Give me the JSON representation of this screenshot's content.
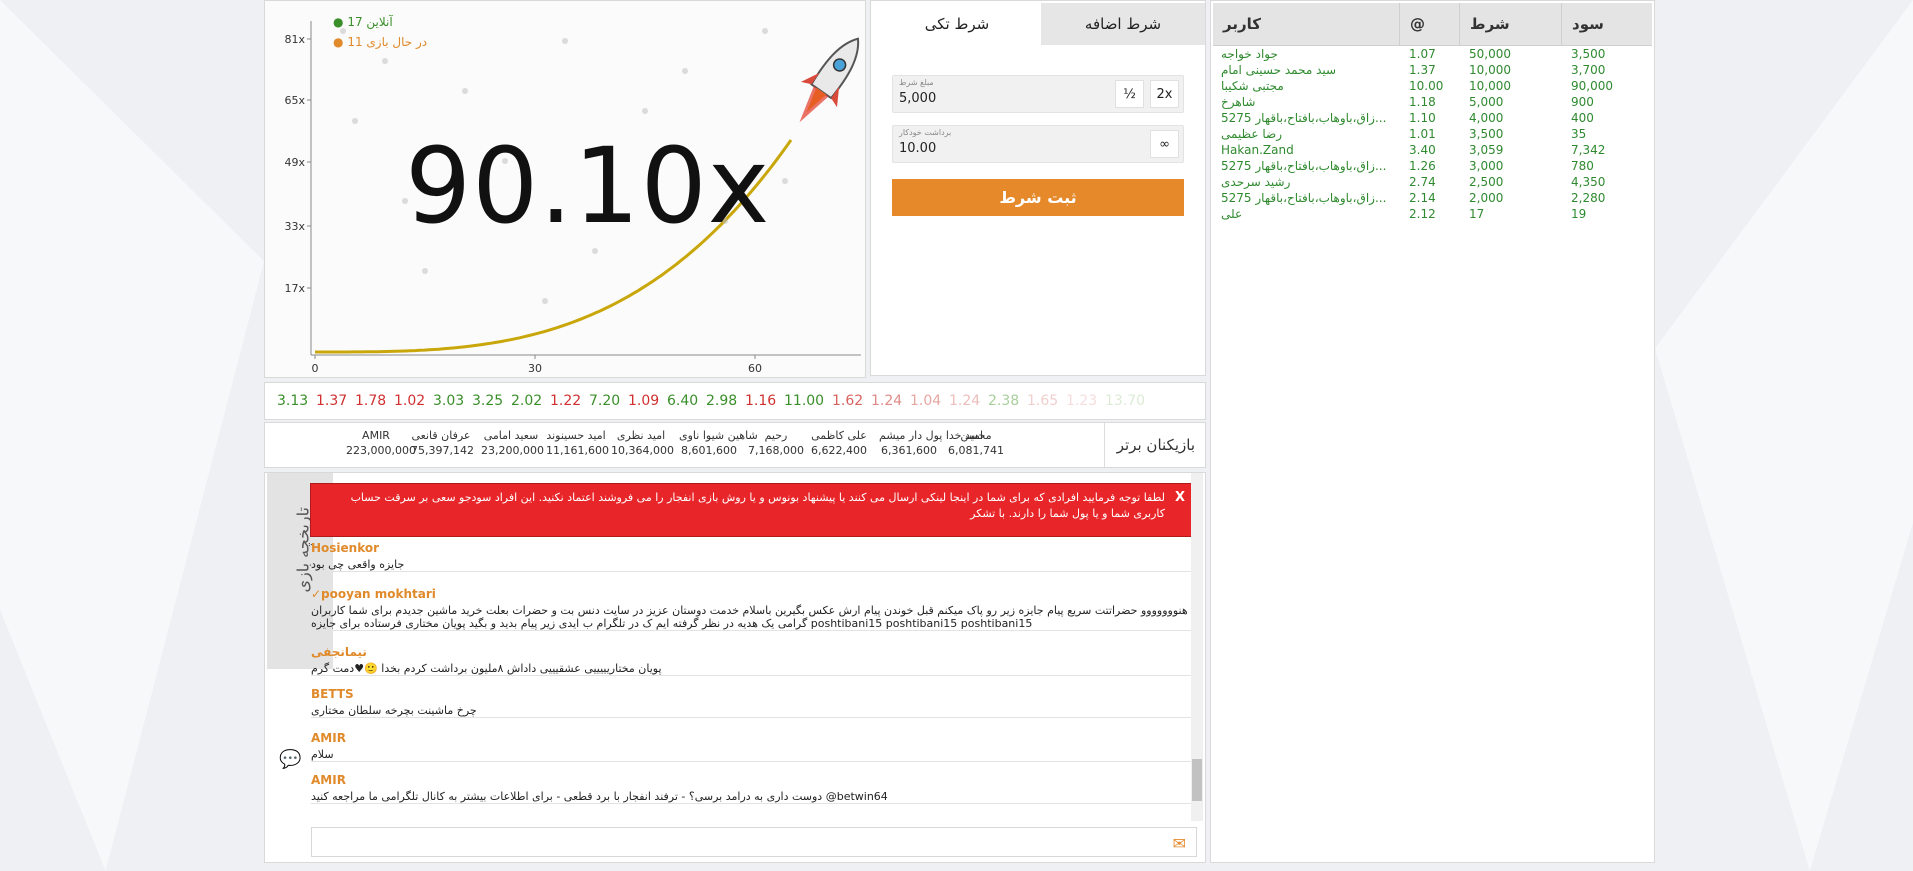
{
  "chart": {
    "multiplier": "90.10x",
    "online_label": "آنلاین 17",
    "playing_label": "در حال بازی 11",
    "online_color": "#3a8f2a",
    "playing_color": "#e08a2b",
    "curve_color": "#c9a70a",
    "y_ticks": [
      "81x",
      "65x",
      "49x",
      "33x",
      "17x"
    ],
    "x_ticks": [
      "0",
      "30",
      "60"
    ]
  },
  "bet": {
    "tab_single": "شرط تکی",
    "tab_extra": "شرط اضافه",
    "amount_label": "مبلغ شرط",
    "amount_value": "5,000",
    "half_label": "½",
    "double_label": "2x",
    "cashout_label": "برداشت خودکار",
    "cashout_value": "10.00",
    "infinity_label": "∞",
    "submit_label": "ثبت شرط",
    "accent": "#e6892a"
  },
  "bets_table": {
    "headers": {
      "user": "کاربر",
      "at": "@",
      "bet": "شرط",
      "profit": "سود"
    },
    "rows": [
      {
        "user": "جواد خواجه",
        "at": "1.07",
        "bet": "50,000",
        "profit": "3,500"
      },
      {
        "user": "سید محمد حسینی امام",
        "at": "1.37",
        "bet": "10,000",
        "profit": "3,700"
      },
      {
        "user": "مجتبی شکیبا",
        "at": "10.00",
        "bet": "10,000",
        "profit": "90,000"
      },
      {
        "user": "شاهرخ",
        "at": "1.18",
        "bet": "5,000",
        "profit": "900"
      },
      {
        "user": "زاق،باوهاب،بافتاح،باقهار 5275...",
        "at": "1.10",
        "bet": "4,000",
        "profit": "400"
      },
      {
        "user": "رضا عظیمی",
        "at": "1.01",
        "bet": "3,500",
        "profit": "35"
      },
      {
        "user": "Hakan.Zand",
        "at": "3.40",
        "bet": "3,059",
        "profit": "7,342"
      },
      {
        "user": "زاق،باوهاب،بافتاح،باقهار 5275...",
        "at": "1.26",
        "bet": "3,000",
        "profit": "780"
      },
      {
        "user": "رشید سرحدی",
        "at": "2.74",
        "bet": "2,500",
        "profit": "4,350"
      },
      {
        "user": "زاق،باوهاب،بافتاح،باقهار 5275...",
        "at": "2.14",
        "bet": "2,000",
        "profit": "2,280"
      },
      {
        "user": "علی",
        "at": "2.12",
        "bet": "17",
        "profit": "19"
      }
    ]
  },
  "history": [
    {
      "value": "3.13",
      "color": "#3a8f2a"
    },
    {
      "value": "1.37",
      "color": "#d03030"
    },
    {
      "value": "1.78",
      "color": "#d03030"
    },
    {
      "value": "1.02",
      "color": "#d03030"
    },
    {
      "value": "3.03",
      "color": "#3a8f2a"
    },
    {
      "value": "3.25",
      "color": "#3a8f2a"
    },
    {
      "value": "2.02",
      "color": "#3a8f2a"
    },
    {
      "value": "1.22",
      "color": "#d03030"
    },
    {
      "value": "7.20",
      "color": "#3a8f2a"
    },
    {
      "value": "1.09",
      "color": "#d03030"
    },
    {
      "value": "6.40",
      "color": "#3a8f2a"
    },
    {
      "value": "2.98",
      "color": "#3a8f2a"
    },
    {
      "value": "1.16",
      "color": "#d03030"
    },
    {
      "value": "11.00",
      "color": "#3a8f2a"
    },
    {
      "value": "1.62",
      "color": "#d8625e"
    },
    {
      "value": "1.24",
      "color": "#df8a86"
    },
    {
      "value": "1.04",
      "color": "#e6a6a3"
    },
    {
      "value": "1.24",
      "color": "#ecbdba"
    },
    {
      "value": "2.38",
      "color": "#a8cf9c"
    },
    {
      "value": "1.65",
      "color": "#f1cfcd"
    },
    {
      "value": "1.23",
      "color": "#f5dedd"
    },
    {
      "value": "13.70",
      "color": "#dcebd6"
    }
  ],
  "top_players": {
    "title": "بازیکنان برتر",
    "players": [
      {
        "name": "AMIR",
        "amount": "223,000,000"
      },
      {
        "name": "عرفان قانعی",
        "amount": "75,397,142"
      },
      {
        "name": "سعید امامی",
        "amount": "23,200,000"
      },
      {
        "name": "امید حسینوند",
        "amount": "11,161,600"
      },
      {
        "name": "امید نظری",
        "amount": "10,364,000"
      },
      {
        "name": "شاهین شیوا ناوی",
        "amount": "8,601,600"
      },
      {
        "name": "رحیم",
        "amount": "7,168,000"
      },
      {
        "name": "علی کاظمی",
        "amount": "6,622,400"
      },
      {
        "name": "امید خدا پول دار میشم",
        "amount": "6,361,600"
      },
      {
        "name": "محسن",
        "amount": "6,081,741"
      }
    ]
  },
  "chat": {
    "history_tab": "تاریخچه بازی",
    "alert_close": "X",
    "alert_text": "لطفا توجه فرمایید افرادی که برای شما در اینجا لینکی ارسال می کنند یا پیشنهاد بونوس و یا روش بازی انفجار را می فروشند اعتماد نکنید. این افراد سودجو سعی بر سرقت حساب کاربری شما و یا پول شما را دارند. با تشکر",
    "messages": [
      {
        "user": "Hosienkor",
        "text": "جایزه واقعی چی بود"
      },
      {
        "user": "✓pooyan mokhtari",
        "text": "هنووووووو حضراتتت سریع پیام جایزه زیر رو پاک میکنم قبل خوندن پیام ارش عکس بگیرین باسلام خدمت دوستان عزیز در سایت دنس بت و حضرات بعلت خرید ماشین جدیدم برای شما کاربران گرامی یک هدیه در نظر گرفته ایم ک در تلگرام ب ایدی زیر پیام بدید و بگید پویان مختاری فرستاده برای جایزه poshtibani15 poshtibani15 poshtibani15"
      },
      {
        "user": "نیمانجفی",
        "text": "پویان مختاریییییی عشقیییی داداش ۸ملیون برداشت کردم بخدا 🙂♥دمت گرم"
      },
      {
        "user": "BETTS",
        "text": "چرخ ماشینت بچرخه سلطان مختاری"
      },
      {
        "user": "AMIR",
        "text": "سلام"
      },
      {
        "user": "AMIR",
        "text": "دوست داری به درامد برسی؟ - ترفند انفجار با برد قطعی - برای اطلاعات بیشتر به کانال تلگرامی ما مراجعه کنید @betwin64"
      }
    ]
  }
}
